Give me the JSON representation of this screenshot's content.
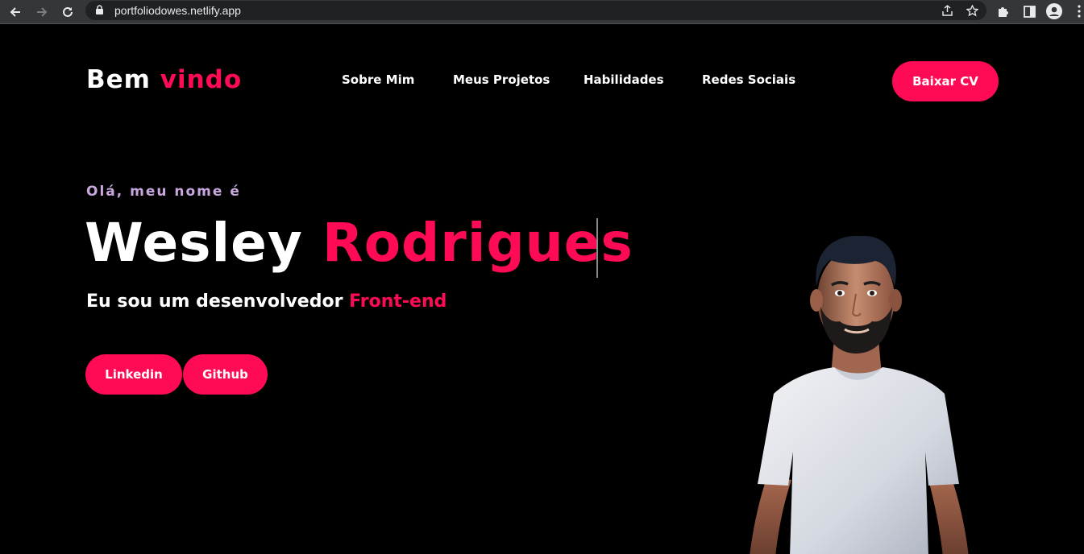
{
  "browser": {
    "url": "portfoliodowes.netlify.app"
  },
  "header": {
    "logo_main": "Bem",
    "logo_accent": "vindo",
    "nav": [
      "Sobre Mim",
      "Meus Projetos",
      "Habilidades",
      "Redes Sociais"
    ],
    "cta_label": "Baixar CV"
  },
  "hero": {
    "greeting": "Olá, meu nome é",
    "first_name": "Wesley",
    "last_name": "Rodrigues",
    "subtitle_main": "Eu sou um desenvolvedor",
    "subtitle_accent": "Front-end",
    "buttons": [
      "Linkedin",
      "Github"
    ]
  },
  "colors": {
    "accent": "#ff0b55",
    "background": "#000000",
    "greeting": "#c9a8e0"
  }
}
